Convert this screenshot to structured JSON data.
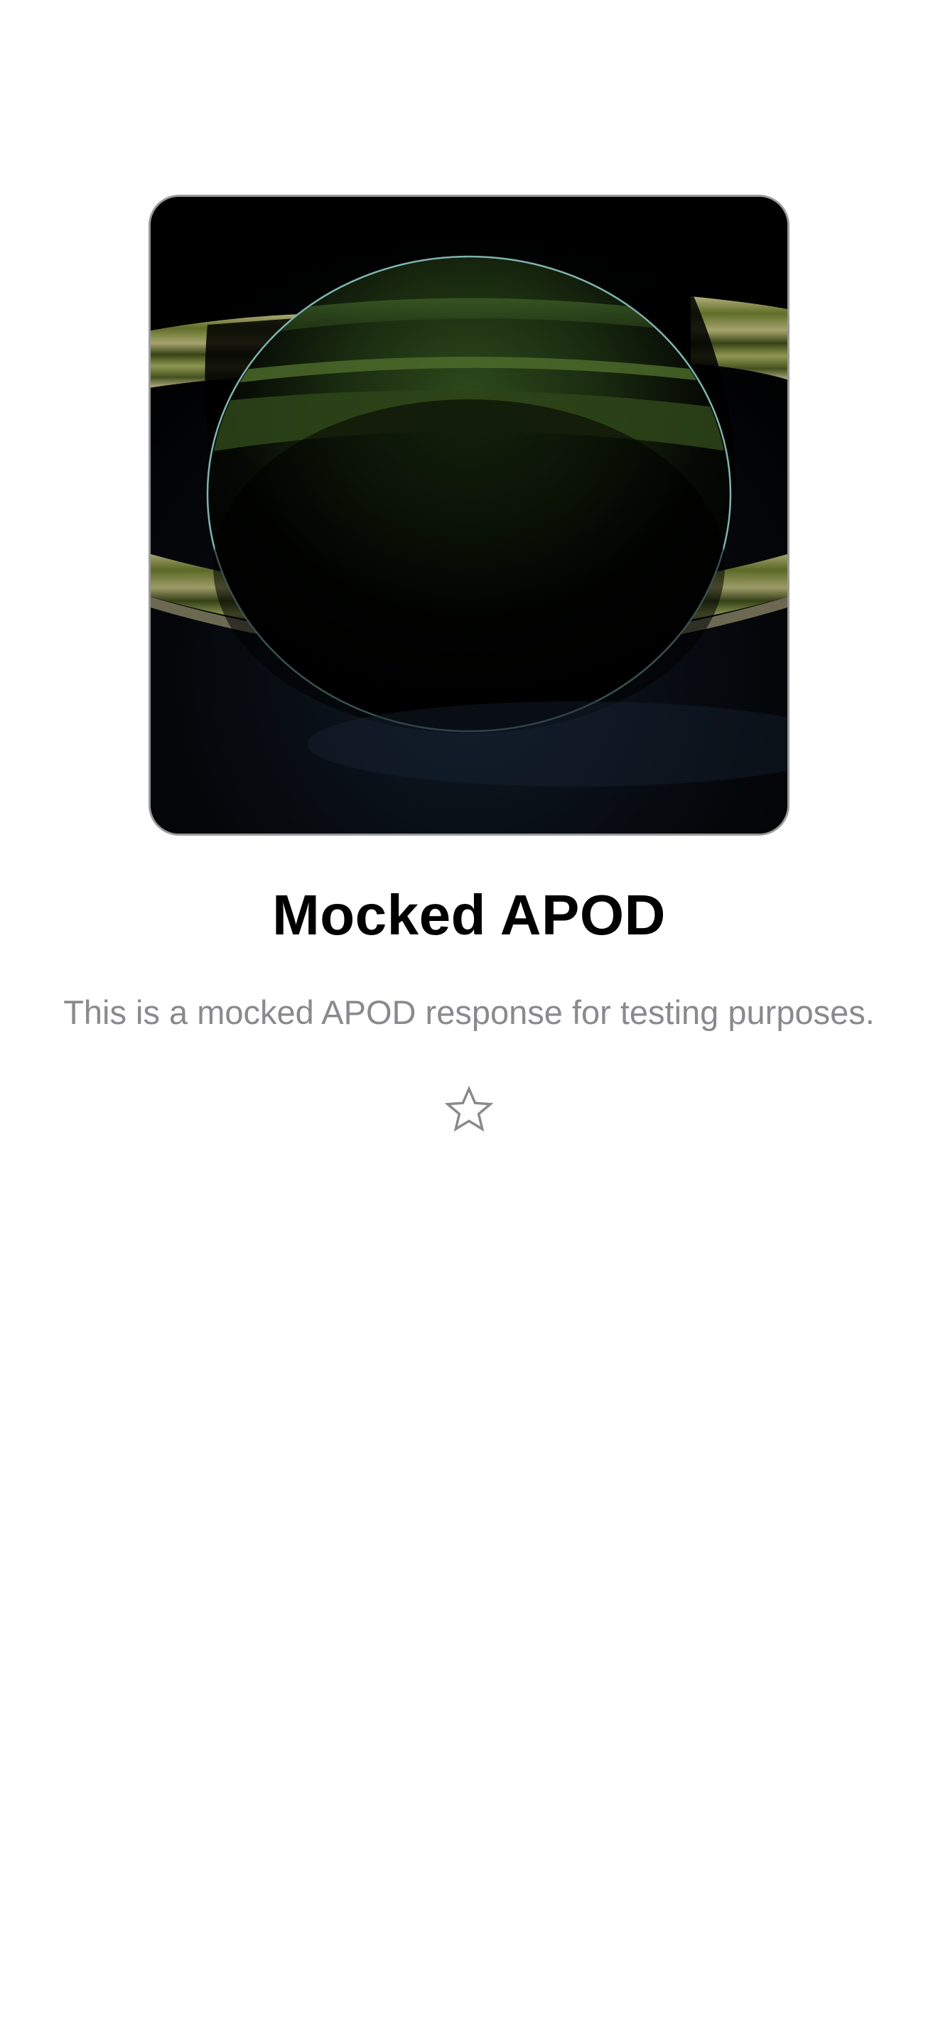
{
  "apod": {
    "title": "Mocked APOD",
    "explanation": "This is a mocked APOD response for testing purposes.",
    "image_description": "Saturn backlit by the sun with glowing rings",
    "favorite_icon": "star-outline-icon",
    "favorited": false
  },
  "colors": {
    "background": "#ffffff",
    "title": "#000000",
    "explanation": "#8a8a8e",
    "star_outline": "#8a8a8e"
  }
}
